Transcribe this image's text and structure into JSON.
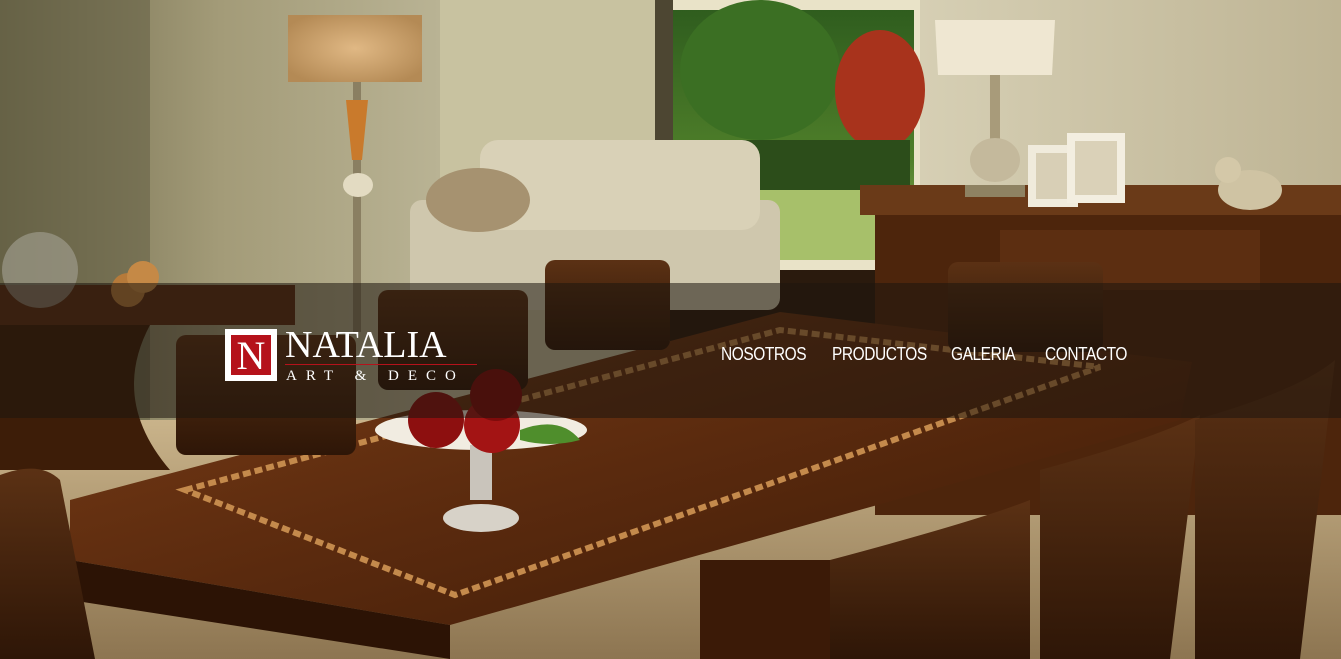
{
  "logo": {
    "letter": "N",
    "name": "NATALIA",
    "tagline": "ART & DECO"
  },
  "nav": {
    "items": [
      {
        "label": "NOSOTROS"
      },
      {
        "label": "PRODUCTOS"
      },
      {
        "label": "GALERIA"
      },
      {
        "label": "CONTACTO"
      }
    ]
  },
  "colors": {
    "brand_red": "#b5121b",
    "nav_text": "#ffffff",
    "navbar_overlay": "rgba(30,22,14,0.55)"
  }
}
